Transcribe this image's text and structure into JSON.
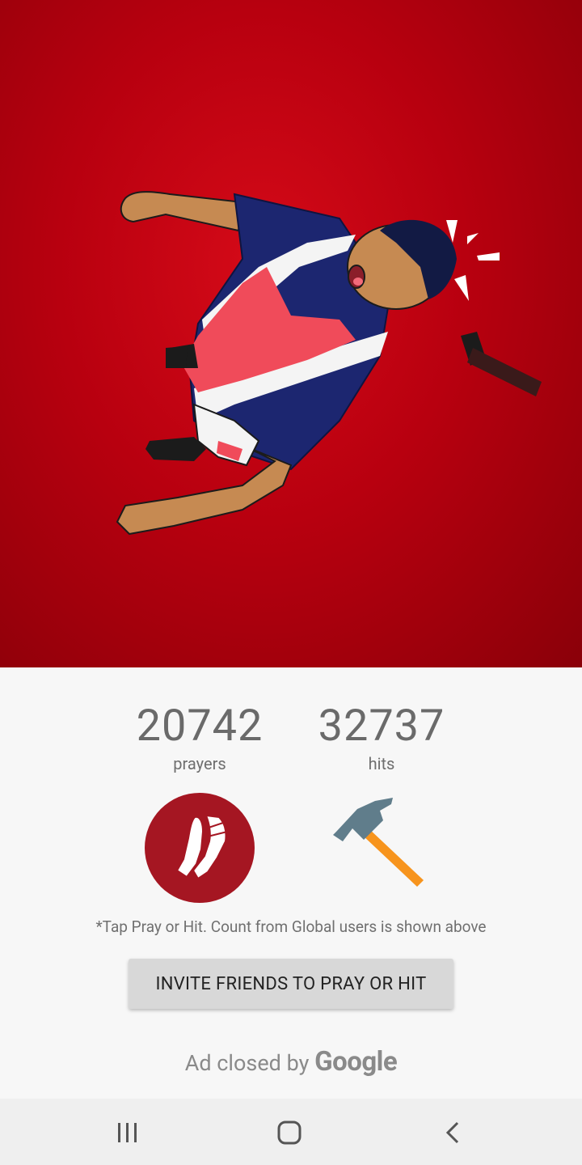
{
  "counters": {
    "prayers": {
      "value": "20742",
      "label": "prayers"
    },
    "hits": {
      "value": "32737",
      "label": "hits"
    }
  },
  "actions": {
    "pray_icon": "praying-hands-icon",
    "hit_icon": "hammer-icon"
  },
  "hint": "*Tap Pray or Hit. Count from Global users is shown above",
  "invite_button": "INVITE FRIENDS TO PRAY OR HIT",
  "ad": {
    "text": "Ad closed by",
    "brand": "Google"
  },
  "navbar": {
    "recents_icon": "recents-icon",
    "home_icon": "home-icon",
    "back_icon": "back-icon"
  },
  "colors": {
    "hero_red": "#c00612",
    "pray_button": "#a51622",
    "hammer_handle": "#f7941d",
    "hammer_head": "#607d8b"
  }
}
